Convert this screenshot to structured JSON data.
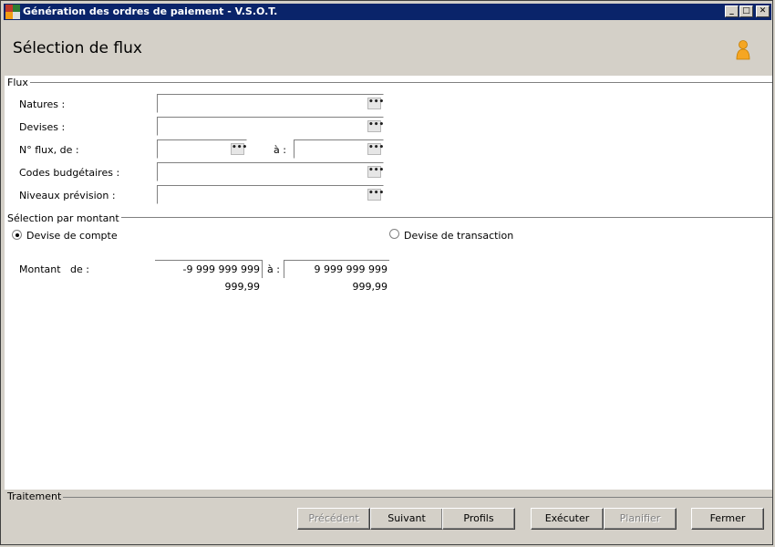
{
  "window": {
    "title": "Génération des ordres de paiement - V.S.O.T.",
    "minimize_glyph": "_",
    "maximize_glyph": "□",
    "close_glyph": "✕"
  },
  "header": {
    "title": "Sélection de flux",
    "user_icon": "user-icon"
  },
  "flux": {
    "section_label": "Flux",
    "fields": {
      "natures_label": "Natures :",
      "natures_value": "",
      "devises_label": "Devises :",
      "devises_value": "",
      "nflux_label": "N° flux, de :",
      "nflux_from": "",
      "nflux_to_label": "à :",
      "nflux_to": "",
      "codes_label": "Codes budgétaires :",
      "codes_value": "",
      "niveaux_label": "Niveaux prévision :",
      "niveaux_value": ""
    },
    "browse_glyph": "•••"
  },
  "montant": {
    "section_label": "Sélection par montant",
    "radio_compte": "Devise de compte",
    "radio_transaction": "Devise de transaction",
    "selected": "compte",
    "label": "Montant   de :",
    "from_value": "-9 999 999 999 999,99",
    "to_label": "à :",
    "to_value": "9 999 999 999 999,99"
  },
  "footer": {
    "section_label": "Traitement",
    "buttons": {
      "precedent": "Précédent",
      "suivant": "Suivant",
      "profils": "Profils",
      "executer": "Exécuter",
      "planifier": "Planifier",
      "fermer": "Fermer"
    }
  },
  "colors": {
    "titlebar": "#0a246a",
    "background": "#d4d0c8",
    "content": "#ffffff"
  }
}
